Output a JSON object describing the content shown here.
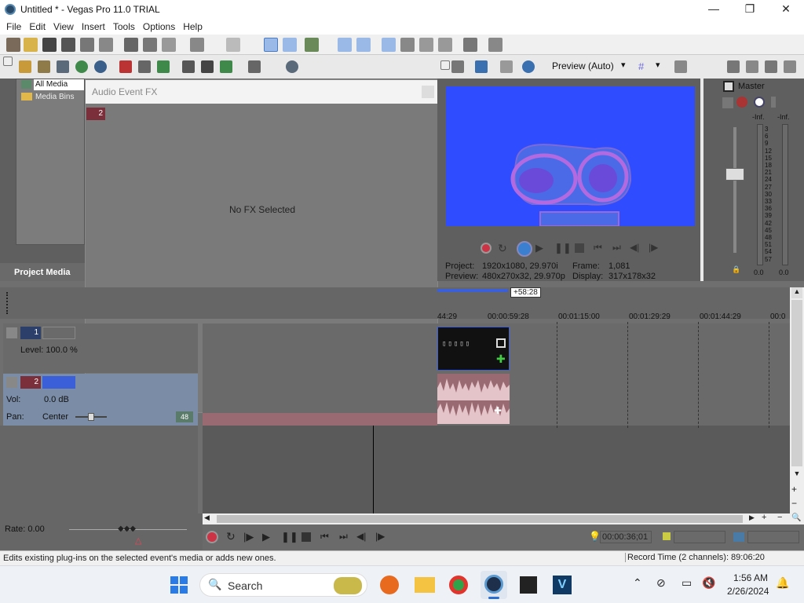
{
  "window": {
    "title": "Untitled * - Vegas Pro 11.0 TRIAL",
    "minimize": "—",
    "maximize": "❐",
    "close": "✕"
  },
  "menu": [
    "File",
    "Edit",
    "View",
    "Insert",
    "Tools",
    "Options",
    "Help"
  ],
  "project_media": {
    "tree": [
      "All Media",
      "Media Bins"
    ],
    "tab_label": "Project Media"
  },
  "fx_dialog": {
    "title": "Audio Event FX",
    "track_badge": "2",
    "message": "No FX Selected"
  },
  "preview": {
    "mode": "Preview (Auto)",
    "project_label": "Project:",
    "project_value": "1920x1080, 29.970i",
    "preview_label": "Preview:",
    "preview_value": "480x270x32, 29.970p",
    "frame_label": "Frame:",
    "frame_value": "1,081",
    "display_label": "Display:",
    "display_value": "317x178x32"
  },
  "master": {
    "label": "Master",
    "left_level": "-Inf.",
    "right_level": "-Inf.",
    "scale": [
      "3",
      "6",
      "9",
      "12",
      "15",
      "18",
      "21",
      "24",
      "27",
      "30",
      "33",
      "36",
      "39",
      "42",
      "45",
      "48",
      "51",
      "54",
      "57"
    ],
    "left_value": "0.0",
    "right_value": "0.0"
  },
  "timeline": {
    "region_marker": "+58:28",
    "ruler": [
      "44:29",
      "00:00:59:28",
      "00:01:15:00",
      "00:01:29:29",
      "00:01:44:29",
      "00:0"
    ]
  },
  "tracks": {
    "video": {
      "number": "1",
      "level": "Level: 100.0 %"
    },
    "audio": {
      "number": "2",
      "vol_label": "Vol:",
      "vol_value": "0.0 dB",
      "pan_label": "Pan:",
      "pan_value": "Center",
      "badge": "48"
    }
  },
  "transport": {
    "rate": "Rate: 0.00",
    "time": "00:00:36;01"
  },
  "status": {
    "hint": "Edits existing plug-ins on the selected event's media or adds new ones.",
    "record_time": "Record Time (2 channels): 89:06:20"
  },
  "taskbar": {
    "search": "Search",
    "time": "1:56 AM",
    "date": "2/26/2024"
  },
  "colors": {
    "accent_audio": "#7b2f3a",
    "preview_bg": "#2f4dff",
    "selection_blue": "#3a5fd8"
  }
}
